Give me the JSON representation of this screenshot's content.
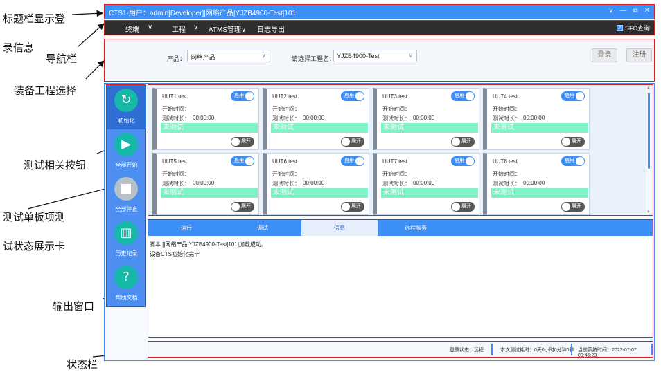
{
  "annotations": {
    "title_bar_1": "标题栏显示登",
    "title_bar_2": "录信息",
    "nav_bar": "导航栏",
    "project_select": "装备工程选择",
    "test_buttons": "测试相关按钮",
    "card_1": "测试单板项测",
    "card_2": "试状态展示卡",
    "output_window": "输出窗口",
    "status_bar": "状态栏"
  },
  "titlebar": {
    "title": "CTS1-用户：admin[Developer]|网络产品|YJZB4900-Test|101",
    "controls": [
      "∨",
      "—",
      "⧉",
      "✕"
    ]
  },
  "nav": {
    "items": [
      {
        "label": "终端"
      },
      {
        "label": "∨"
      },
      {
        "label": "工程"
      },
      {
        "label": "∨"
      },
      {
        "label": "ATMS管理∨"
      },
      {
        "label": "日志导出"
      }
    ],
    "sfc_label": "SFC查询",
    "sfc_checked": true
  },
  "project": {
    "product_label": "产品：",
    "product_value": "网络产品",
    "project_label": "请选择工程名：",
    "project_value": "YJZB4900-Test",
    "login_button": "登录",
    "register_button": "注册"
  },
  "sidebar": {
    "items": [
      {
        "label": "初始化",
        "icon": "refresh-icon",
        "glyph": "↻",
        "active": true
      },
      {
        "label": "全部开始",
        "icon": "play-icon",
        "glyph": "▶",
        "active": false
      },
      {
        "label": "全部停止",
        "icon": "stop-icon",
        "glyph": "",
        "active": false
      },
      {
        "label": "历史记录",
        "icon": "bar-chart-icon",
        "glyph": "▥",
        "active": false
      },
      {
        "label": "帮助文档",
        "icon": "help-icon",
        "glyph": "?",
        "active": false
      }
    ]
  },
  "cards": [
    {
      "name": "UUT1 test",
      "enable": "启用",
      "start_label": "开始时间：",
      "start_value": "",
      "dur_label": "测试时长：",
      "dur_value": "00:00:00",
      "status": "未测试",
      "expand": "展开"
    },
    {
      "name": "UUT2 test",
      "enable": "启用",
      "start_label": "开始时间：",
      "start_value": "",
      "dur_label": "测试时长：",
      "dur_value": "00:00:00",
      "status": "未测试",
      "expand": "展开"
    },
    {
      "name": "UUT3 test",
      "enable": "启用",
      "start_label": "开始时间：",
      "start_value": "",
      "dur_label": "测试时长：",
      "dur_value": "00:00:00",
      "status": "未测试",
      "expand": "展开"
    },
    {
      "name": "UUT4 test",
      "enable": "启用",
      "start_label": "开始时间：",
      "start_value": "",
      "dur_label": "测试时长：",
      "dur_value": "00:00:00",
      "status": "未测试",
      "expand": "展开"
    },
    {
      "name": "UUT5 test",
      "enable": "启用",
      "start_label": "开始时间：",
      "start_value": "",
      "dur_label": "测试时长：",
      "dur_value": "00:00:00",
      "status": "未测试",
      "expand": "展开"
    },
    {
      "name": "UUT6 test",
      "enable": "启用",
      "start_label": "开始时间：",
      "start_value": "",
      "dur_label": "测试时长：",
      "dur_value": "00:00:00",
      "status": "未测试",
      "expand": "展开"
    },
    {
      "name": "UUT7 test",
      "enable": "启用",
      "start_label": "开始时间：",
      "start_value": "",
      "dur_label": "测试时长：",
      "dur_value": "00:00:00",
      "status": "未测试",
      "expand": "展开"
    },
    {
      "name": "UUT8 test",
      "enable": "启用",
      "start_label": "开始时间：",
      "start_value": "",
      "dur_label": "测试时长：",
      "dur_value": "00:00:00",
      "status": "未测试",
      "expand": "展开"
    }
  ],
  "output": {
    "tabs": [
      {
        "label": "运行",
        "active": false
      },
      {
        "label": "调试",
        "active": false
      },
      {
        "label": "信息",
        "active": true
      },
      {
        "label": "远程服务",
        "active": false
      }
    ],
    "log_lines": [
      "脚本 [|网络产品|YJZB4900-Test|101]加载成功。",
      "设备CTS初始化完毕"
    ]
  },
  "status": {
    "login_status": "登录状态：远程",
    "test_time": "本次测试耗时：0天0小时0分钟0秒",
    "system_time": "当前系统时间：2023-07-07 09:45:23"
  },
  "colors": {
    "accent": "#3b8ff7",
    "sidebar": "#4c8ff0",
    "teal": "#16b8a8",
    "status_untested": "#7ff2c6",
    "highlight_border": "#d02020"
  }
}
